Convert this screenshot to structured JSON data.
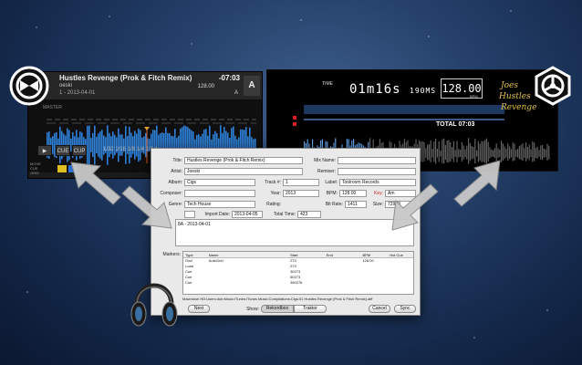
{
  "traktor": {
    "title": "Hustles Revenge (Prok & Fitch Remix)",
    "artist": "oeski",
    "date": "1 - 2013-04-01",
    "time": "-07:03",
    "bpm": "128.00",
    "pitch": "0.0",
    "key": "A",
    "deck": "A",
    "buttons": {
      "play": "▶",
      "cue": "CUE",
      "cup": "CUP"
    },
    "loop_sizes": "1/32 1/16 1/8 1/4 1/2 1",
    "side_labels": [
      "MOVE",
      "CUE",
      "GRID"
    ],
    "master_label": "MASTER"
  },
  "rekordbox": {
    "time_label": "TIME",
    "time": "01m16s",
    "time_ms": "190MS",
    "bpm": "128.00",
    "bpm_unit": "BPM",
    "total": "TOTAL 07:03",
    "artwork_text": [
      "Joes",
      "Hustles",
      "Revenge"
    ]
  },
  "dialog": {
    "labels": {
      "title": "Title:",
      "mix_name": "Mix Name:",
      "artist": "Artist:",
      "remixer": "Remixer:",
      "album": "Album:",
      "track": "Track #:",
      "label": "Label:",
      "composer": "Composer:",
      "year": "Year:",
      "bpm": "BPM:",
      "key": "Key:",
      "genre": "Genre:",
      "rating": "Rating:",
      "bitrate": "Bit Rate:",
      "size": "Size:",
      "import_date": "Import Date:",
      "total_time": "Total Time:",
      "markers": "Markers:"
    },
    "values": {
      "title": "Hustles Revenge (Prok & Fitch Remix)",
      "mix_name": "",
      "artist": "Joeski",
      "remixer": "",
      "album": "Cigs",
      "track": "1",
      "label": "Toolroom Records",
      "composer": "",
      "year": "2013",
      "bpm": "128.00",
      "key": "Am",
      "genre": "Tech House",
      "rating": "",
      "bitrate": "1411",
      "size": "72979",
      "import_date": "2013-04-05",
      "total_time": "423",
      "comment": "8A - 2013-04-01"
    },
    "markers": {
      "headers": [
        "Type",
        "Name",
        "Start",
        "End",
        "BPM",
        "Hot Cue"
      ],
      "rows": [
        [
          "Grid",
          "AutoGrid",
          "273",
          "",
          "128.00",
          ""
        ],
        [
          "Load",
          "",
          "273",
          "",
          "",
          ""
        ],
        [
          "Cue",
          "",
          "30273",
          "",
          "",
          ""
        ],
        [
          "Cue",
          "",
          "60273",
          "",
          "",
          ""
        ],
        [
          "Cue",
          "",
          "390276",
          "",
          "",
          ""
        ]
      ]
    },
    "path": "Macintosh HD:Users:dob:Music:iTunes:iTunes Music:Compilations:Cigs:01 Hustles Revenge (Prok & Fitch Remix).aiff",
    "buttons": {
      "next": "Next",
      "show": "Show:",
      "rekordbox": "Rekordbox",
      "traktor": "Traktor",
      "cancel": "Cancel",
      "sync": "Sync"
    }
  },
  "colors": {
    "traktor_wave": "#2e7fd6",
    "rekordbox_wave": "#6fb3ff",
    "artwork": "#e2c044"
  }
}
